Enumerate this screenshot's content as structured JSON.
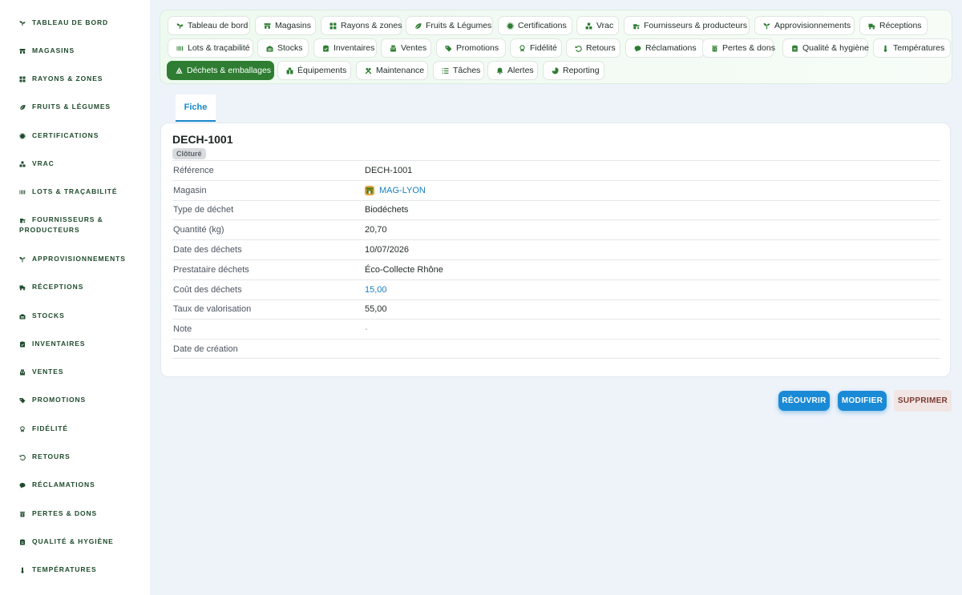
{
  "sidebar": {
    "items": [
      {
        "label": "TABLEAU DE BORD",
        "icon": "sprout-icon"
      },
      {
        "label": "MAGASINS",
        "icon": "store-icon"
      },
      {
        "label": "RAYONS & ZONES",
        "icon": "grid-icon"
      },
      {
        "label": "FRUITS & LÉGUMES",
        "icon": "leaf-icon"
      },
      {
        "label": "CERTIFICATIONS",
        "icon": "certificate-icon"
      },
      {
        "label": "VRAC",
        "icon": "boxes-icon"
      },
      {
        "label": "LOTS & TRAÇABILITÉ",
        "icon": "barcode-icon"
      },
      {
        "label": "FOURNISSEURS &",
        "label2": "PRODUCTEURS",
        "icon": "tractor-icon"
      },
      {
        "label": "APPROVISIONNEMENTS",
        "icon": "seedling-icon"
      },
      {
        "label": "RÉCEPTIONS",
        "icon": "truck-icon"
      },
      {
        "label": "STOCKS",
        "icon": "warehouse-icon"
      },
      {
        "label": "INVENTAIRES",
        "icon": "clipboard-icon"
      },
      {
        "label": "VENTES",
        "icon": "cash-register-icon"
      },
      {
        "label": "PROMOTIONS",
        "icon": "tag-icon"
      },
      {
        "label": "FIDÉLITÉ",
        "icon": "award-icon"
      },
      {
        "label": "RETOURS",
        "icon": "undo-icon"
      },
      {
        "label": "RÉCLAMATIONS",
        "icon": "comment-icon"
      },
      {
        "label": "PERTES & DONS",
        "icon": "trash-icon"
      },
      {
        "label": "QUALITÉ & HYGIÈNE",
        "icon": "clipboard-check-icon"
      },
      {
        "label": "TEMPÉRATURES",
        "icon": "thermometer-icon"
      }
    ]
  },
  "topnav": {
    "items": [
      {
        "label": "Tableau de bord",
        "icon": "sprout-icon"
      },
      {
        "label": "Magasins",
        "icon": "store-icon"
      },
      {
        "label": "Rayons & zones",
        "icon": "grid-icon"
      },
      {
        "label": "Fruits & Légumes",
        "icon": "leaf-icon"
      },
      {
        "label": "Certifications",
        "icon": "certificate-icon"
      },
      {
        "label": "Vrac",
        "icon": "boxes-icon"
      },
      {
        "label": "Fournisseurs & producteurs",
        "icon": "tractor-icon"
      },
      {
        "label": "Approvisionnements",
        "icon": "seedling-icon"
      },
      {
        "label": "Réceptions",
        "icon": "truck-icon"
      },
      {
        "label": "Lots & traçabilité",
        "icon": "barcode-icon"
      },
      {
        "label": "Stocks",
        "icon": "warehouse-icon"
      },
      {
        "label": "Inventaires",
        "icon": "clipboard-icon"
      },
      {
        "label": "Ventes",
        "icon": "cash-register-icon"
      },
      {
        "label": "Promotions",
        "icon": "tag-icon"
      },
      {
        "label": "Fidélité",
        "icon": "award-icon"
      },
      {
        "label": "Retours",
        "icon": "undo-icon"
      },
      {
        "label": "Réclamations",
        "icon": "comment-icon"
      },
      {
        "label": "Pertes & dons",
        "icon": "trash-icon"
      },
      {
        "label": "Qualité & hygiène",
        "icon": "clipboard-check-icon"
      },
      {
        "label": "Températures",
        "icon": "thermometer-icon"
      },
      {
        "label": "Déchets & emballages",
        "icon": "recycle-icon",
        "active": true
      },
      {
        "label": "Équipements",
        "icon": "equipment-icon"
      },
      {
        "label": "Maintenance",
        "icon": "tools-icon"
      },
      {
        "label": "Tâches",
        "icon": "list-icon"
      },
      {
        "label": "Alertes",
        "icon": "bell-icon"
      },
      {
        "label": "Reporting",
        "icon": "pie-chart-icon"
      }
    ]
  },
  "tabs": {
    "fiche": "Fiche"
  },
  "record": {
    "title": "DECH-1001",
    "status": "Clôturé",
    "fields": [
      {
        "key": "Référence",
        "value": "DECH-1001"
      },
      {
        "key": "Magasin",
        "value": "MAG-LYON",
        "link": true,
        "icon": "store-icon"
      },
      {
        "key": "Type de déchet",
        "value": "Biodéchets"
      },
      {
        "key": "Quantité (kg)",
        "value": "20,70"
      },
      {
        "key": "Date des déchets",
        "value": "10/07/2026"
      },
      {
        "key": "Prestataire déchets",
        "value": "Éco-Collecte Rhône"
      },
      {
        "key": "Coût des déchets",
        "value": "15,00",
        "link": true
      },
      {
        "key": "Taux de valorisation",
        "value": "55,00"
      },
      {
        "key": "Note",
        "value": "-",
        "muted": true
      },
      {
        "key": "Date de création",
        "value": ""
      }
    ]
  },
  "actions": {
    "reopen": "RÉOUVRIR",
    "edit": "MODIFIER",
    "delete": "SUPPRIMER"
  },
  "colors": {
    "brand_green": "#2e7d32",
    "accent_blue": "#1b8ad6",
    "sidebar_text": "#1f4b2c"
  }
}
